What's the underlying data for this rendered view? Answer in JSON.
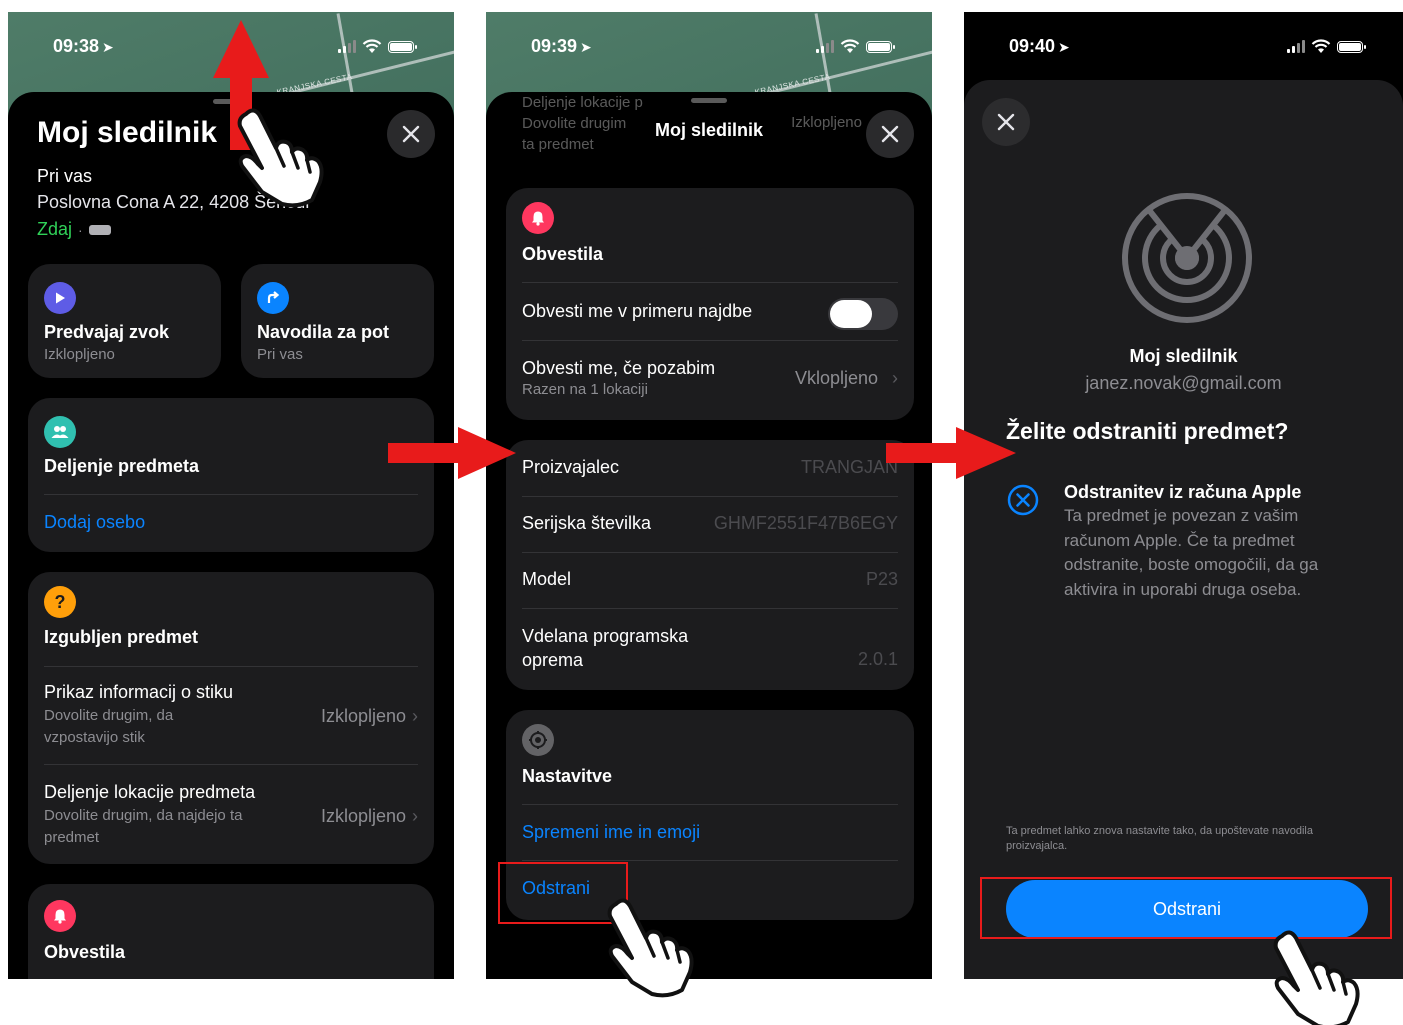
{
  "map_label": "KRANJSKA CESTA",
  "screen1": {
    "time": "09:38",
    "title": "Moj sledilnik",
    "near_label": "Pri vas",
    "address": "Poslovna Cona A 22, 4208 Šenčur",
    "now_label": "Zdaj",
    "play_sound": {
      "label": "Predvajaj zvok",
      "sub": "Izklopljeno"
    },
    "directions": {
      "label": "Navodila za pot",
      "sub": "Pri vas"
    },
    "sharing": {
      "title": "Deljenje predmeta",
      "add_person": "Dodaj osebo"
    },
    "lost": {
      "title": "Izgubljen predmet",
      "contact_label": "Prikaz informacij o stiku",
      "contact_sub": "Dovolite drugim, da vzpostavijo stik",
      "contact_value": "Izklopljeno",
      "loc_label": "Deljenje lokacije predmeta",
      "loc_sub": "Dovolite drugim, da najdejo ta predmet",
      "loc_value": "Izklopljeno"
    },
    "notifications_title": "Obvestila"
  },
  "screen2": {
    "time": "09:39",
    "header_title": "Moj sledilnik",
    "faded_line1": "Deljenje lokacije p",
    "faded_line2": "Dovolite drugim",
    "faded_line3": "ta predmet",
    "faded_right": "Izklopljeno",
    "notifications": {
      "title": "Obvestila",
      "notify_found": "Obvesti me v primeru najdbe",
      "notify_forgot": "Obvesti me, če pozabim",
      "notify_forgot_sub": "Razen na 1 lokaciji",
      "notify_forgot_value": "Vklopljeno"
    },
    "info": {
      "manufacturer_label": "Proizvajalec",
      "manufacturer_value": "TRANGJAN",
      "serial_label": "Serijska številka",
      "serial_value": "GHMF2551F47B6EGY",
      "model_label": "Model",
      "model_value": "P23",
      "firmware_label_1": "Vdelana programska",
      "firmware_label_2": "oprema",
      "firmware_value": "2.0.1"
    },
    "settings": {
      "title": "Nastavitve",
      "rename": "Spremeni ime in emoji",
      "remove": "Odstrani"
    }
  },
  "screen3": {
    "time": "09:40",
    "item_name": "Moj sledilnik",
    "email": "janez.novak@gmail.com",
    "question": "Želite odstraniti predmet?",
    "remove_title": "Odstranitev iz računa Apple",
    "remove_desc": "Ta predmet je povezan z vašim računom Apple. Če ta predmet odstranite, boste omogočili, da ga aktivira in uporabi druga oseba.",
    "footnote": "Ta predmet lahko znova nastavite tako, da upoštevate navodila proizvajalca.",
    "button": "Odstrani"
  },
  "colors": {
    "accent_blue": "#0a84ff",
    "annotation_red": "#e81b1b",
    "play_purple": "#5e5ce6",
    "people_teal": "#30c0b0",
    "lost_orange": "#ff9f0a",
    "bell_red": "#ff375f",
    "now_green": "#30d158"
  }
}
